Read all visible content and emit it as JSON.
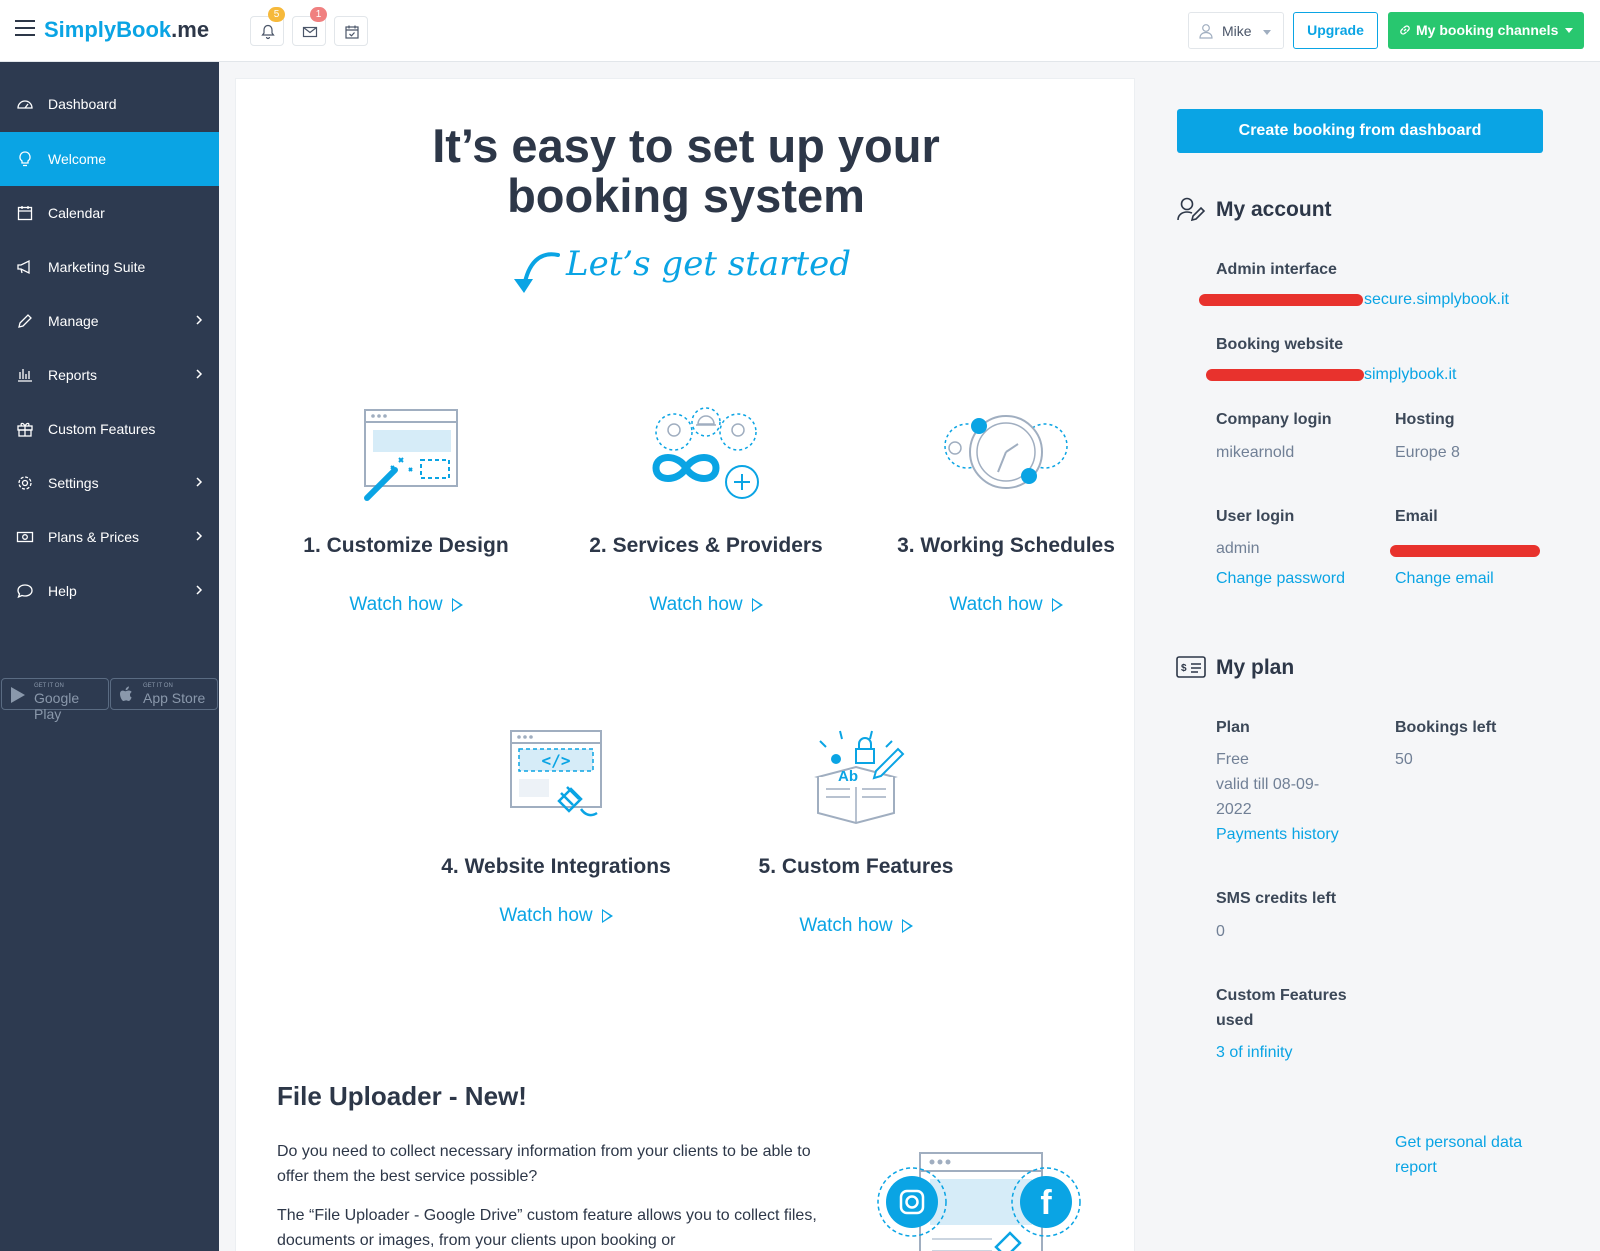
{
  "brand": {
    "logo_blue": "SimplyBook",
    "logo_dark": ".me"
  },
  "topbar": {
    "notifications_count": "5",
    "messages_count": "1",
    "user_name": "Mike",
    "upgrade_label": "Upgrade",
    "channels_label": "My booking channels"
  },
  "sidebar": {
    "items": [
      {
        "label": "Dashboard",
        "icon": "dashboard-icon"
      },
      {
        "label": "Welcome",
        "icon": "lightbulb-icon"
      },
      {
        "label": "Calendar",
        "icon": "calendar-icon"
      },
      {
        "label": "Marketing Suite",
        "icon": "megaphone-icon"
      },
      {
        "label": "Manage",
        "icon": "pencil-icon"
      },
      {
        "label": "Reports",
        "icon": "bar-chart-icon"
      },
      {
        "label": "Custom Features",
        "icon": "gift-box-icon"
      },
      {
        "label": "Settings",
        "icon": "gear-icon"
      },
      {
        "label": "Plans & Prices",
        "icon": "money-icon"
      },
      {
        "label": "Help",
        "icon": "chat-icon"
      }
    ],
    "google_play_small": "GET IT ON",
    "google_play_big": "Google Play",
    "app_store_small": "GET IT ON",
    "app_store_big": "App Store"
  },
  "main": {
    "hero_line1": "It’s easy to set up your",
    "hero_line2": "booking system",
    "subtitle": "Let’s get started",
    "watch_label": "Watch how",
    "steps": [
      {
        "title": "1. Customize Design"
      },
      {
        "title": "2. Services & Providers"
      },
      {
        "title": "3. Working Schedules"
      },
      {
        "title": "4. Website Integrations"
      },
      {
        "title": "5. Custom Features"
      }
    ],
    "file_uploader_title": "File Uploader - New!",
    "file_uploader_p1": "Do you need to collect necessary information from your clients to be able to offer them the best service possible?",
    "file_uploader_p2": "The “File Uploader - Google Drive” custom feature allows you to collect files, documents or images, from your clients upon booking or"
  },
  "right": {
    "create_booking_label": "Create booking from dashboard",
    "my_account_title": "My account",
    "admin_interface_label": "Admin interface",
    "admin_interface_value": "secure.simplybook.it",
    "booking_website_label": "Booking website",
    "booking_website_value": "simplybook.it",
    "company_login_label": "Company login",
    "company_login_value": "mikearnold",
    "hosting_label": "Hosting",
    "hosting_value": "Europe 8",
    "user_login_label": "User login",
    "user_login_value": "admin",
    "email_label": "Email",
    "change_password": "Change password",
    "change_email": "Change email",
    "my_plan_title": "My plan",
    "plan_label": "Plan",
    "plan_value": "Free",
    "plan_valid_line1": "valid till 08-09-",
    "plan_valid_line2": "2022",
    "payments_history": "Payments history",
    "bookings_left_label": "Bookings left",
    "bookings_left_value": "50",
    "sms_label": "SMS credits left",
    "sms_value": "0",
    "custom_features_label_line1": "Custom Features",
    "custom_features_label_line2": "used",
    "custom_features_value": "3 of infinity",
    "personal_report_line1": "Get personal data",
    "personal_report_line2": "report"
  },
  "colors": {
    "accent": "#0aa4e4",
    "sidebar": "#2d3a50",
    "green": "#28c76f",
    "redaction": "#e8322d"
  }
}
